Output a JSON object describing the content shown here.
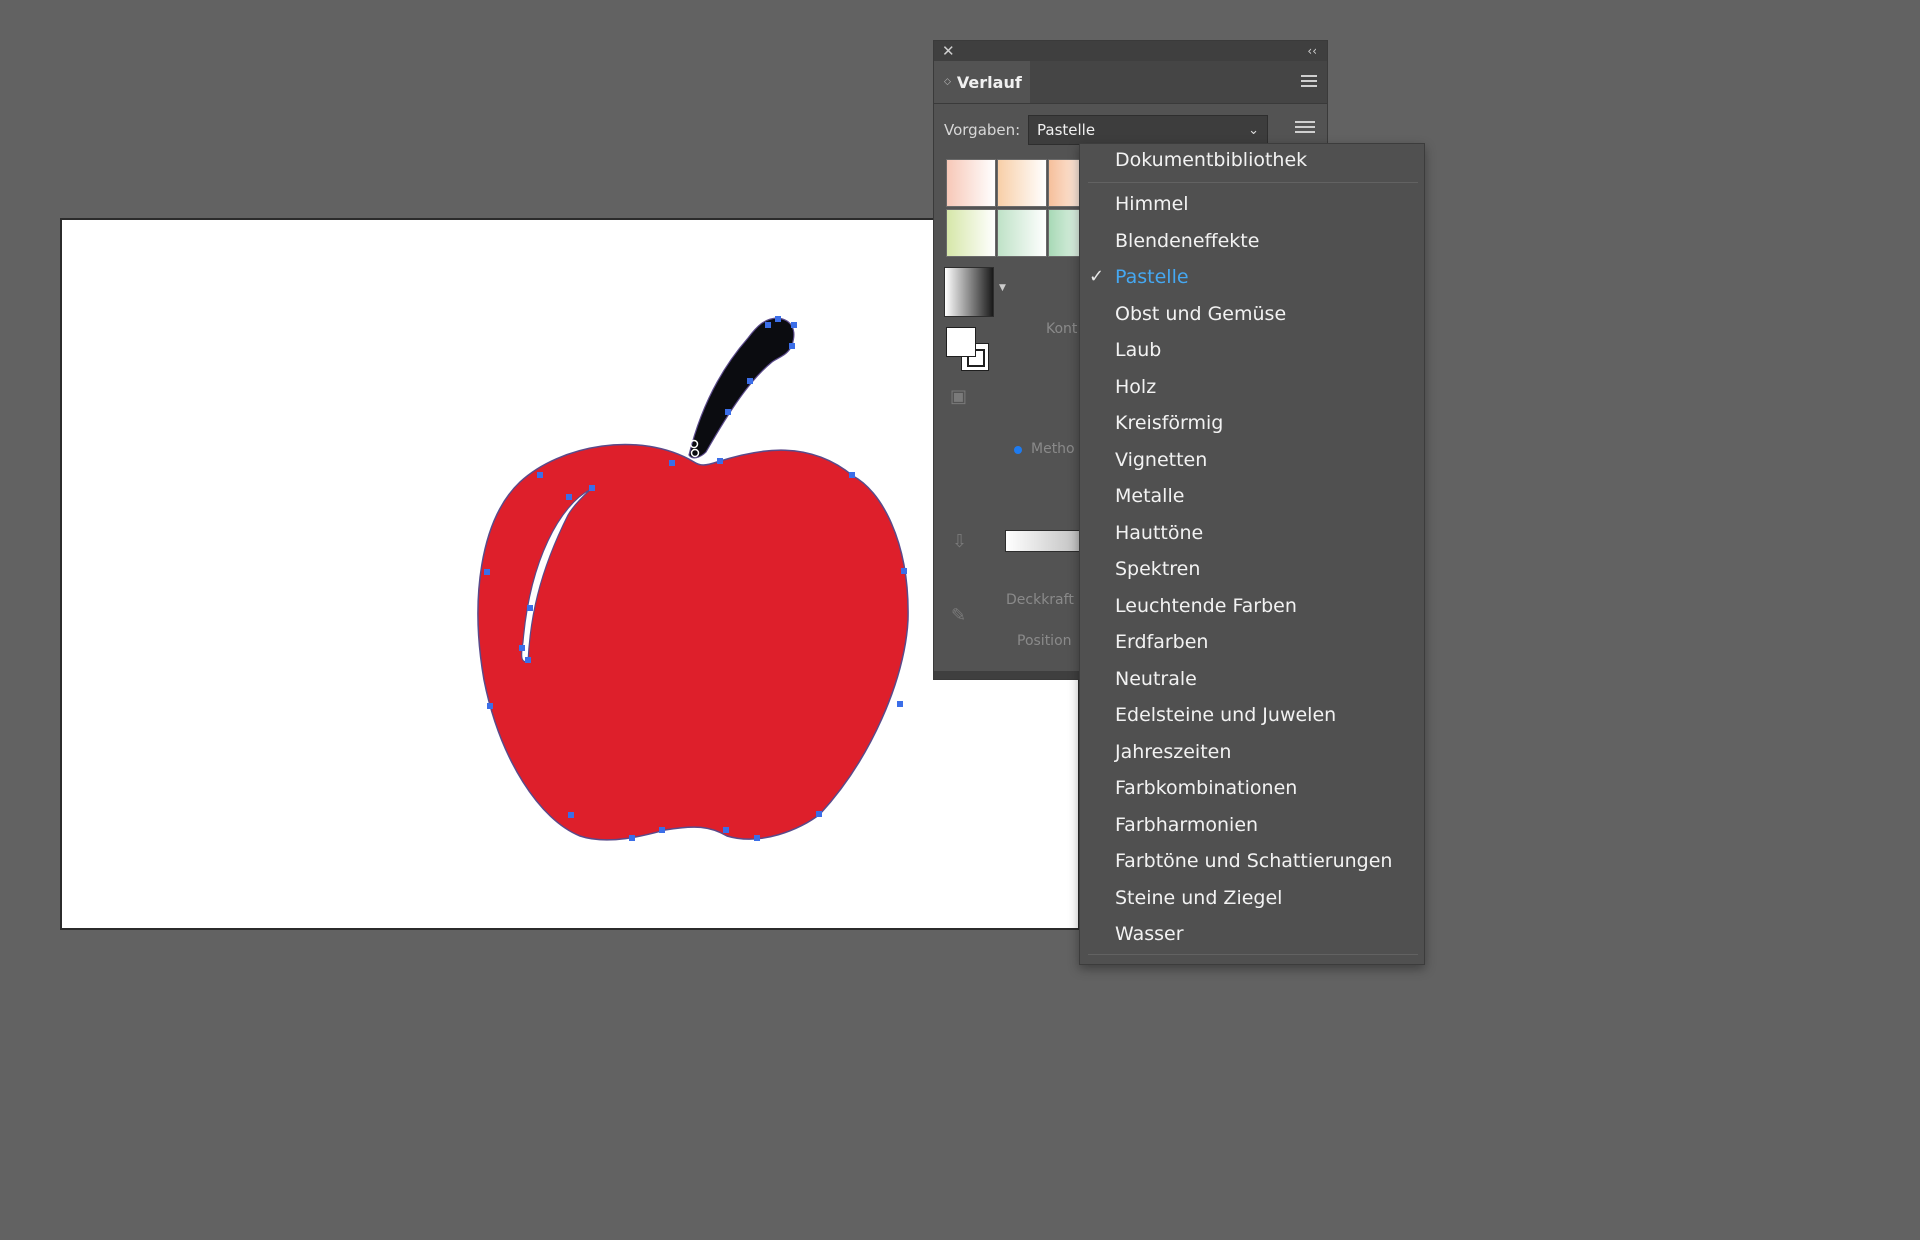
{
  "panel": {
    "tab_label": "Verlauf",
    "close_icon": "close-icon",
    "collapse_icon": "double-chevron-left-icon",
    "menu_icon": "hamburger-menu-icon",
    "presets_label": "Vorgaben:",
    "presets_value": "Pastelle",
    "truncated_labels": {
      "contour": "Kont",
      "method": "Metho",
      "opacity": "Deckkraft",
      "position": "Position"
    }
  },
  "swatches": {
    "colors": [
      "#f7c8b8",
      "#f8cfa8",
      "#f6c09c",
      "#d6e7a9",
      "#bfe2c7",
      "#a8d9b6"
    ]
  },
  "menu": {
    "header_item": "Dokumentbibliothek",
    "selected": "Pastelle",
    "items": [
      "Himmel",
      "Blendeneffekte",
      "Pastelle",
      "Obst und Gemüse",
      "Laub",
      "Holz",
      "Kreisförmig",
      "Vignetten",
      "Metalle",
      "Hauttöne",
      "Spektren",
      "Leuchtende Farben",
      "Erdfarben",
      "Neutrale",
      "Edelsteine und Juwelen",
      "Jahreszeiten",
      "Farbkombinationen",
      "Farbharmonien",
      "Farbtöne und Schattierungen",
      "Steine und Ziegel",
      "Wasser"
    ]
  },
  "colors": {
    "workspace": "#626262",
    "apple_fill": "#de1f2b",
    "stem_fill": "#0b0c10",
    "anchor_point": "#3b6ee8",
    "selected_text": "#45a8f2"
  }
}
